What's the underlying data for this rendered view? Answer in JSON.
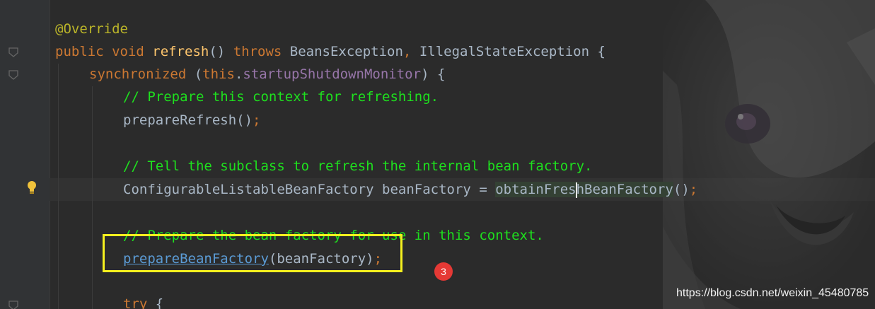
{
  "code": {
    "line_annotation": "@Override",
    "line_signature": {
      "modifiers": "public void ",
      "method": "refresh",
      "parens": "() ",
      "throws_kw": "throws ",
      "exception_1": "BeansException",
      "comma": ", ",
      "exception_2": "IllegalStateException",
      "open_brace": " {"
    },
    "line_sync": {
      "keyword": "synchronized",
      "open": " (",
      "this_kw": "this",
      "dot": ".",
      "field": "startupShutdownMonitor",
      "close": ") {"
    },
    "comment_1": "// Prepare this context for refreshing.",
    "call_prepare_refresh": {
      "name": "prepareRefresh",
      "args": "()",
      "semi": ";"
    },
    "comment_2": "// Tell the subclass to refresh the internal bean factory.",
    "line_bean_factory": {
      "type_and_var": "ConfigurableListableBeanFactory beanFactory = ",
      "call_before_caret": "obtainFres",
      "call_after_caret": "hBeanFactory",
      "args": "()",
      "semi": ";"
    },
    "comment_3": "// Prepare the bean factory for use in this context.",
    "call_prepare_bean_factory": {
      "name": "prepareBeanFactory",
      "args": "(beanFactory)",
      "semi": ";"
    },
    "line_try": {
      "keyword": "try",
      "brace": " {"
    }
  },
  "annotation_badge": {
    "label": "3",
    "color": "#e53935"
  },
  "highlight_box_color": "#f5f01e",
  "watermark": "https://blog.csdn.net/weixin_45480785",
  "icons": [
    "fold-marker-icon",
    "intention-bulb-icon"
  ]
}
